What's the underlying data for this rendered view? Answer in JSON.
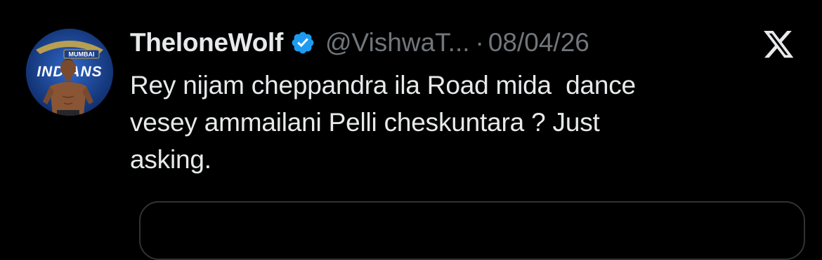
{
  "tweet": {
    "display_name": "TheloneWolf",
    "handle": "@VishwaT...",
    "separator": "·",
    "date": "08/04/26",
    "text_lines": [
      "Rey nijam cheppandra ila Road mida  dance",
      "vesey ammailani Pelli cheskuntara ? Just",
      "asking."
    ],
    "verified": true
  },
  "avatar": {
    "logo_text_top": "MUMBAI",
    "logo_text_bottom": "INDIANS"
  },
  "icons": {
    "verified": "verified-badge-icon",
    "platform": "x-logo-icon"
  },
  "colors": {
    "background": "#000000",
    "primary_text": "#e7e9ea",
    "secondary_text": "#71767b",
    "verified_blue": "#1d9bf0",
    "border": "#2f3336"
  }
}
